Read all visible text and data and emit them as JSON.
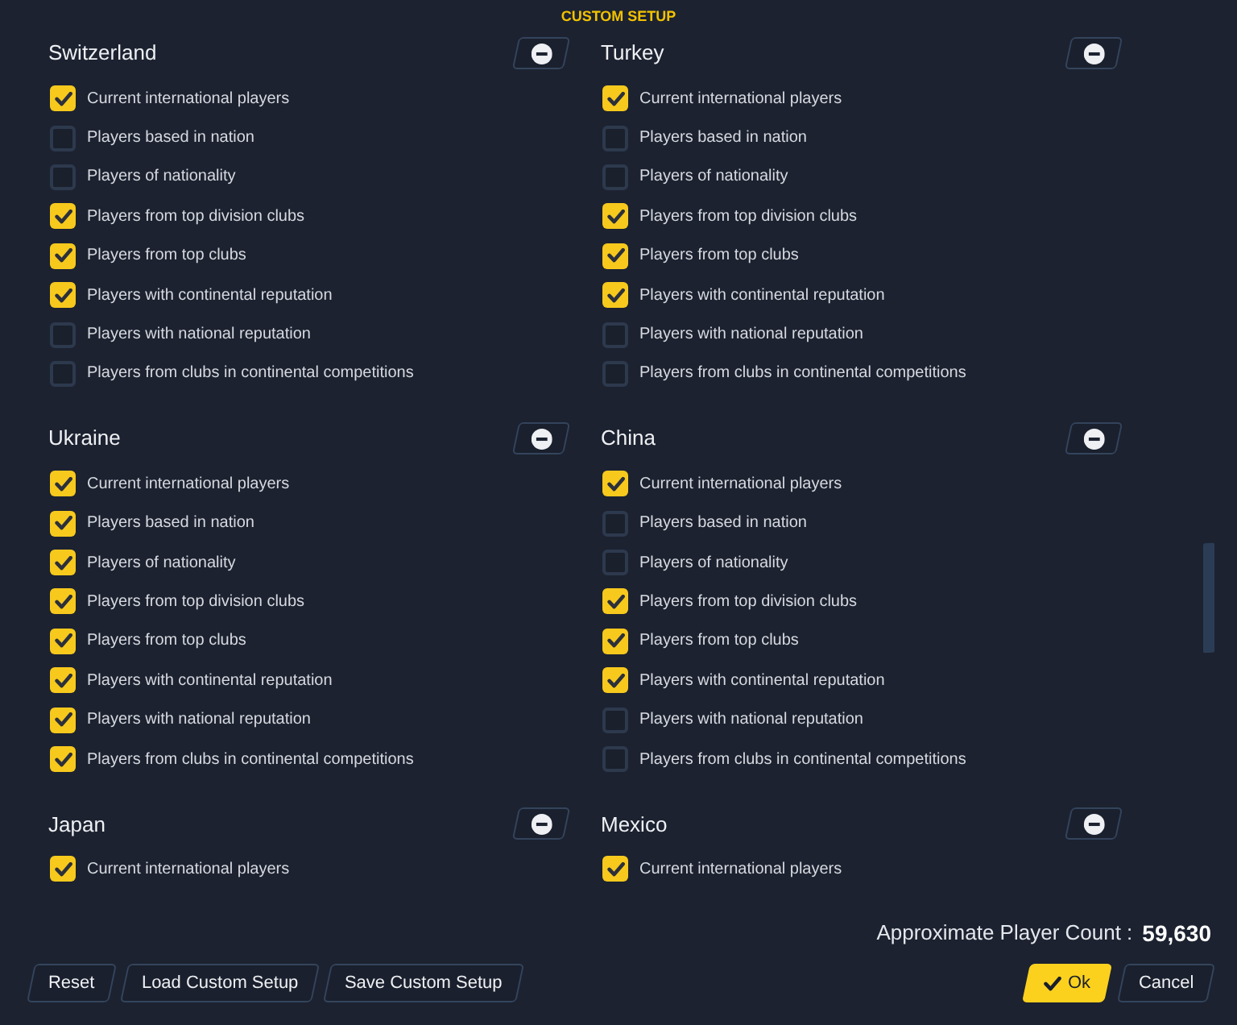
{
  "dialog": {
    "title": "CUSTOM SETUP"
  },
  "nations": [
    {
      "name": "Switzerland",
      "options": [
        {
          "label": "Current international players",
          "checked": true
        },
        {
          "label": "Players based in nation",
          "checked": false
        },
        {
          "label": "Players of nationality",
          "checked": false
        },
        {
          "label": "Players from top division clubs",
          "checked": true
        },
        {
          "label": "Players from top clubs",
          "checked": true
        },
        {
          "label": "Players with continental reputation",
          "checked": true
        },
        {
          "label": "Players with national reputation",
          "checked": false
        },
        {
          "label": "Players from clubs in continental competitions",
          "checked": false
        }
      ]
    },
    {
      "name": "Turkey",
      "options": [
        {
          "label": "Current international players",
          "checked": true
        },
        {
          "label": "Players based in nation",
          "checked": false
        },
        {
          "label": "Players of nationality",
          "checked": false
        },
        {
          "label": "Players from top division clubs",
          "checked": true
        },
        {
          "label": "Players from top clubs",
          "checked": true
        },
        {
          "label": "Players with continental reputation",
          "checked": true
        },
        {
          "label": "Players with national reputation",
          "checked": false
        },
        {
          "label": "Players from clubs in continental competitions",
          "checked": false
        }
      ]
    },
    {
      "name": "Ukraine",
      "options": [
        {
          "label": "Current international players",
          "checked": true
        },
        {
          "label": "Players based in nation",
          "checked": true
        },
        {
          "label": "Players of nationality",
          "checked": true
        },
        {
          "label": "Players from top division clubs",
          "checked": true
        },
        {
          "label": "Players from top clubs",
          "checked": true
        },
        {
          "label": "Players with continental reputation",
          "checked": true
        },
        {
          "label": "Players with national reputation",
          "checked": true
        },
        {
          "label": "Players from clubs in continental competitions",
          "checked": true
        }
      ]
    },
    {
      "name": "China",
      "options": [
        {
          "label": "Current international players",
          "checked": true
        },
        {
          "label": "Players based in nation",
          "checked": false
        },
        {
          "label": "Players of nationality",
          "checked": false
        },
        {
          "label": "Players from top division clubs",
          "checked": true
        },
        {
          "label": "Players from top clubs",
          "checked": true
        },
        {
          "label": "Players with continental reputation",
          "checked": true
        },
        {
          "label": "Players with national reputation",
          "checked": false
        },
        {
          "label": "Players from clubs in continental competitions",
          "checked": false
        }
      ]
    },
    {
      "name": "Japan",
      "options": [
        {
          "label": "Current international players",
          "checked": true
        }
      ]
    },
    {
      "name": "Mexico",
      "options": [
        {
          "label": "Current international players",
          "checked": true
        }
      ]
    }
  ],
  "player_count": {
    "label": "Approximate Player Count :",
    "value": "59,630"
  },
  "footer": {
    "left_buttons": [
      {
        "label": "Reset",
        "kind": "secondary"
      },
      {
        "label": "Load Custom Setup",
        "kind": "secondary"
      },
      {
        "label": "Save Custom Setup",
        "kind": "secondary"
      }
    ],
    "right_buttons": [
      {
        "label": "Ok",
        "kind": "primary"
      },
      {
        "label": "Cancel",
        "kind": "secondary"
      }
    ]
  }
}
